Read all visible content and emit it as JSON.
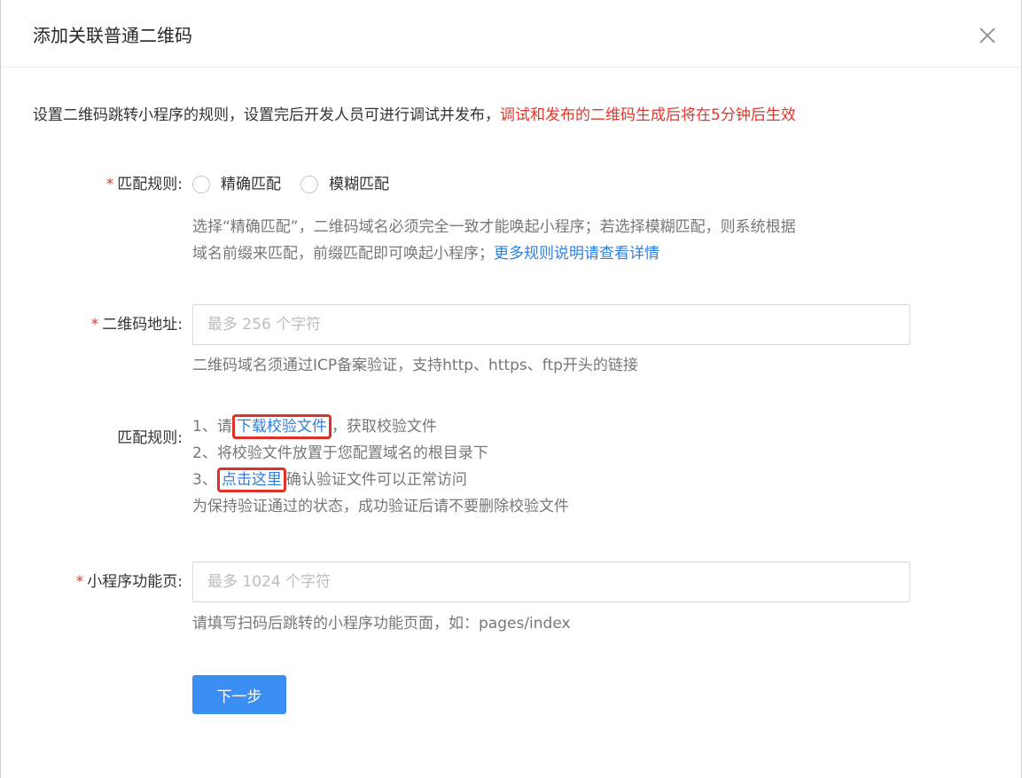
{
  "dialog": {
    "title": "添加关联普通二维码",
    "close_icon": "close-icon"
  },
  "intro": {
    "text": "设置二维码跳转小程序的规则，设置完后开发人员可进行调试并发布，",
    "warning": "调试和发布的二维码生成后将在5分钟后生效"
  },
  "match_rule": {
    "required_mark": "*",
    "label": "匹配规则:",
    "options": [
      "精确匹配",
      "模糊匹配"
    ],
    "help_line1": "选择“精确匹配”，二维码域名必须完全一致才能唤起小程序；若选择模糊匹配，则系统根据",
    "help_line2": "域名前缀来匹配，前缀匹配即可唤起小程序；",
    "help_link": "更多规则说明请查看详情"
  },
  "qr_address": {
    "required_mark": "*",
    "label": "二维码地址:",
    "placeholder": "最多 256 个字符",
    "value": "",
    "help": "二维码域名须通过ICP备案验证，支持http、https、ftp开头的链接"
  },
  "verify_rule": {
    "label": "匹配规则:",
    "step1_prefix": "1、请",
    "step1_link": "下载校验文件",
    "step1_suffix": "，获取校验文件",
    "step2": "2、将校验文件放置于您配置域名的根目录下",
    "step3_prefix": "3、",
    "step3_link": "点击这里",
    "step3_suffix": "确认验证文件可以正常访问",
    "note": "为保持验证通过的状态，成功验证后请不要删除校验文件"
  },
  "mini_page": {
    "required_mark": "*",
    "label": "小程序功能页:",
    "placeholder": "最多 1024 个字符",
    "value": "",
    "help": "请填写扫码后跳转的小程序功能页面，如：pages/index"
  },
  "footer": {
    "next_label": "下一步"
  },
  "colors": {
    "accent": "#3b8ef3",
    "link": "#2f7fe0",
    "warning": "#e8352a",
    "highlight_box": "#e0302a"
  }
}
